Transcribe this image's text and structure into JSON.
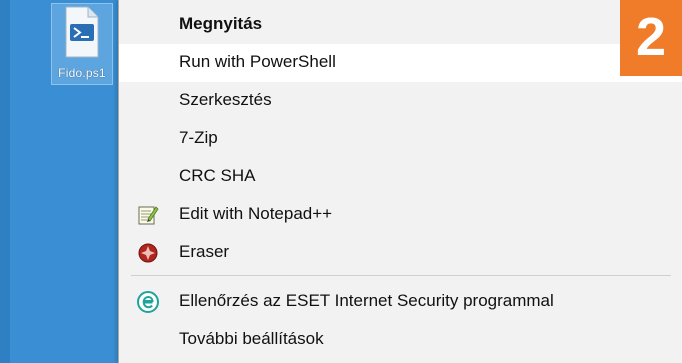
{
  "desktop": {
    "file": {
      "name": "Fido.ps1",
      "icon": "powershell-script-icon"
    }
  },
  "context_menu": {
    "items": [
      {
        "label": "Megnyitás",
        "icon": null
      },
      {
        "label": "Run with PowerShell",
        "icon": null,
        "state": "hover"
      },
      {
        "label": "Szerkesztés",
        "icon": null
      },
      {
        "label": "7-Zip",
        "icon": null
      },
      {
        "label": "CRC SHA",
        "icon": null
      },
      {
        "label": "Edit with Notepad++",
        "icon": "notepad-plus-plus-icon"
      },
      {
        "label": "Eraser",
        "icon": "eraser-icon"
      },
      {
        "label": "Ellenőrzés az ESET Internet Security programmal",
        "icon": "eset-icon"
      },
      {
        "label": "További beállítások",
        "icon": null
      }
    ]
  },
  "step_badge": {
    "text": "2",
    "color": "#f07c2a"
  },
  "colors": {
    "desktop": "#3a8fd4",
    "menu_bg": "#f2f2f2",
    "hover_bg": "#ffffff"
  }
}
